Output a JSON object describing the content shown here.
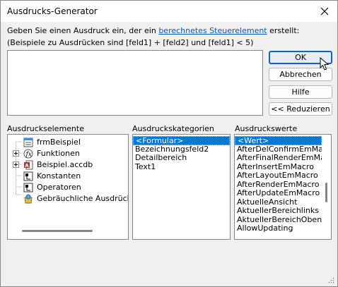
{
  "window": {
    "title": "Ausdrucks-Generator"
  },
  "instructions": {
    "line1_prefix": "Geben Sie einen Ausdruck ein, der ein ",
    "line1_link": "berechnetes Steuerelement",
    "line1_suffix": " erstellt:",
    "line2": "(Beispiele zu Ausdrücken sind [feld1] + [feld2] und [feld1] < 5)"
  },
  "expression": {
    "value": ""
  },
  "buttons": {
    "ok": "OK",
    "cancel": "Abbrechen",
    "help": "Hilfe",
    "reduce": "<< Reduzieren"
  },
  "elements": {
    "label": "Ausdruckselemente",
    "items": [
      {
        "label": "frmBeispiel",
        "icon": "form-icon"
      },
      {
        "label": "Funktionen",
        "icon": "function-icon"
      },
      {
        "label": "Beispiel.accdb",
        "icon": "database-icon"
      },
      {
        "label": "Konstanten",
        "icon": "constants-icon"
      },
      {
        "label": "Operatoren",
        "icon": "operators-icon"
      },
      {
        "label": "Gebräuchliche Ausdrück",
        "icon": "common-expressions-icon"
      }
    ]
  },
  "categories": {
    "label": "Ausdruckskategorien",
    "items": [
      "<Formular>",
      "Bezeichnungsfeld2",
      "Detailbereich",
      "Text1"
    ]
  },
  "values": {
    "label": "Ausdruckswerte",
    "items": [
      "<Wert>",
      "AfterDelConfirmEmMac",
      "AfterFinalRenderEmMa",
      "AfterInsertEmMacro",
      "AfterLayoutEmMacro",
      "AfterRenderEmMacro",
      "AfterUpdateEmMacro",
      "AktuelleAnsicht",
      "AktuellerBereichlinks",
      "AktuellerBereichOben",
      "AllowUpdating"
    ]
  },
  "colors": {
    "accent": "#0078d7",
    "link": "#0a58b8"
  }
}
